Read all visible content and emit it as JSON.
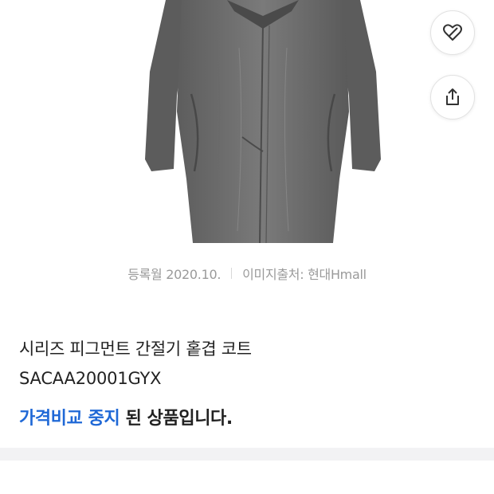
{
  "image_meta": {
    "registered": "등록월 2020.10.",
    "source": "이미지출처: 현대Hmall"
  },
  "product": {
    "name": "시리즈 피그먼트 간절기 홑겹 코트",
    "code": "SACAA20001GYX"
  },
  "status": {
    "highlight": "가격비교 중지",
    "suffix": " 된 상품입니다."
  },
  "actions": {
    "wishlist_icon": "heart-icon",
    "share_icon": "share-icon"
  },
  "colors": {
    "accent": "#1f68d6",
    "muted_text": "#9a9a9a",
    "coat_gray": "#6e6e6e"
  }
}
